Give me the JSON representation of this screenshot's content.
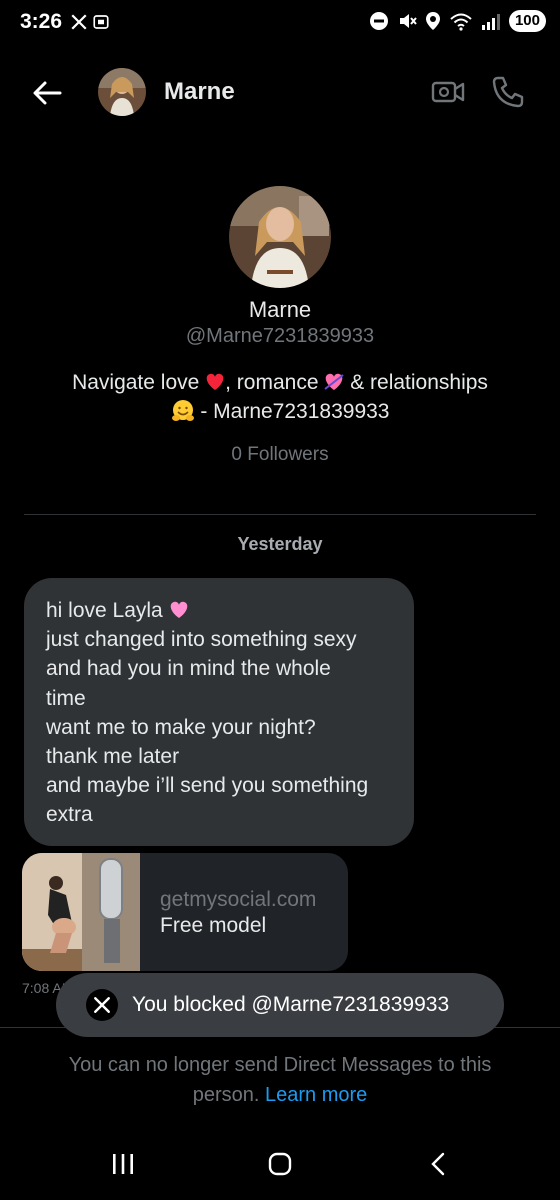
{
  "status_bar": {
    "time": "3:26",
    "battery": "100"
  },
  "header": {
    "name": "Marne"
  },
  "profile": {
    "name": "Marne",
    "handle": "@Marne7231839933",
    "bio_line1_a": "Navigate love ",
    "bio_line1_b": ", romance ",
    "bio_line1_c": " & relationships",
    "bio_line2": " - Marne7231839933",
    "followers": "0 Followers"
  },
  "conversation": {
    "date_label": "Yesterday",
    "message": {
      "line1": "hi love Layla ",
      "line2": "just changed into something sexy",
      "line3": "and had you in mind the whole",
      "line4": "time",
      "line5": "want me to make your night?",
      "line6": "thank me later",
      "line7": "and maybe i’ll send you something",
      "line8": "extra"
    },
    "link_card": {
      "domain": "getmysocial.com",
      "title": "Free model"
    },
    "time": "7:08 AM"
  },
  "toast": {
    "text": "You blocked @Marne7231839933"
  },
  "notice": {
    "text": "You can no longer send Direct Messages to this person. ",
    "link": "Learn more"
  },
  "icons": {
    "back": "arrow-left-icon",
    "video": "video-call-icon",
    "call": "phone-icon",
    "x_logo": "x-logo-icon"
  },
  "colors": {
    "background": "#000000",
    "bubble": "#2f3336",
    "link": "#1d9bf0",
    "muted": "#71767b"
  }
}
